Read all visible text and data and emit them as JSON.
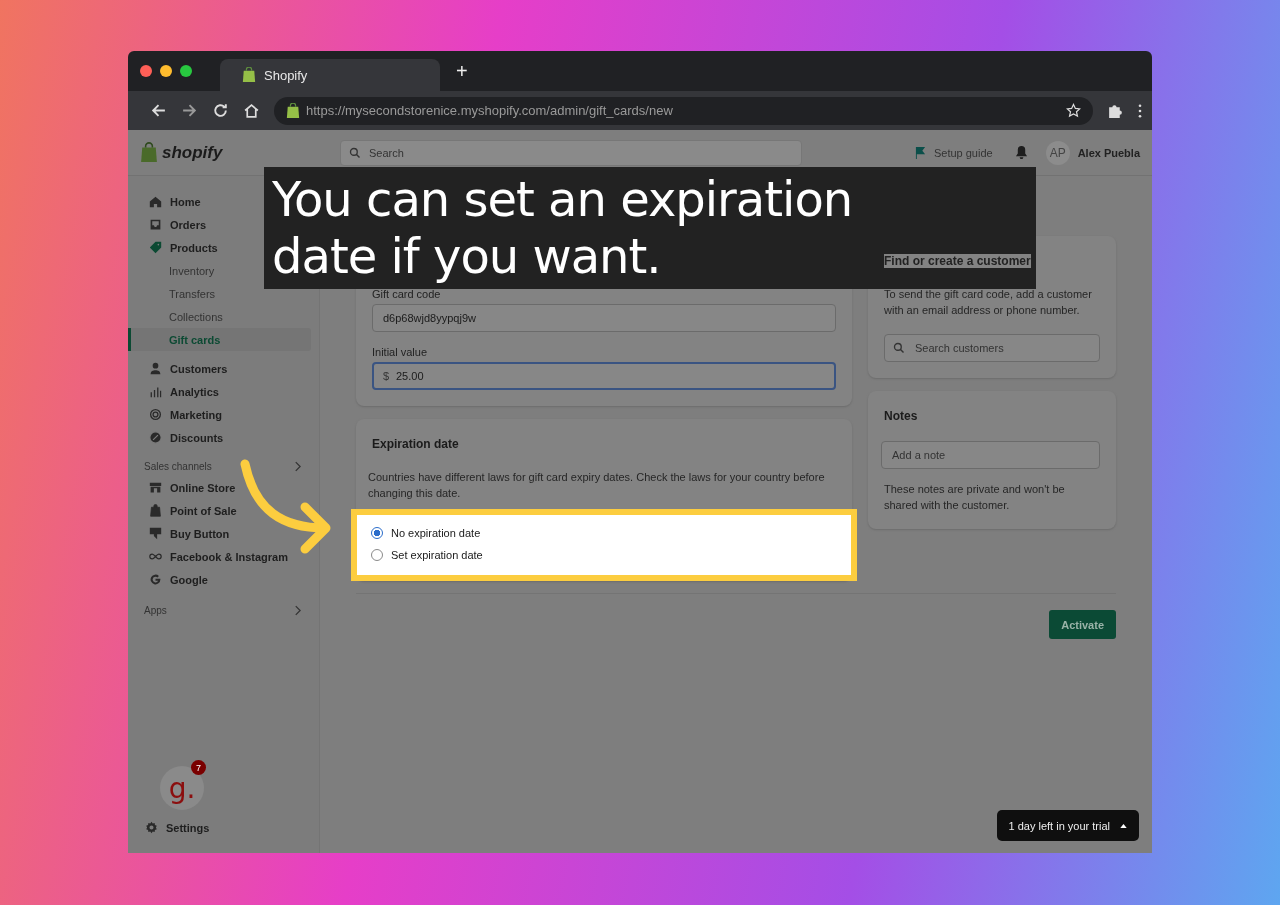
{
  "browser": {
    "tab_title": "Shopify",
    "new_tab": "+",
    "url": "https://mysecondstorenice.myshopify.com/admin/gift_cards/new"
  },
  "topbar": {
    "logo": "shopify",
    "search_placeholder": "Search",
    "setup_guide": "Setup guide",
    "user_initials": "AP",
    "user_name": "Alex Puebla"
  },
  "sidebar": {
    "items": [
      {
        "kind": "home",
        "label": "Home",
        "selected": false
      },
      {
        "kind": "orders",
        "label": "Orders",
        "selected": false
      },
      {
        "kind": "products",
        "label": "Products",
        "selected": false,
        "children": [
          {
            "label": "Inventory",
            "selected": false
          },
          {
            "label": "Transfers",
            "selected": false
          },
          {
            "label": "Collections",
            "selected": false
          },
          {
            "label": "Gift cards",
            "selected": true
          }
        ]
      },
      {
        "kind": "customers",
        "label": "Customers",
        "selected": false
      },
      {
        "kind": "analytics",
        "label": "Analytics",
        "selected": false
      },
      {
        "kind": "marketing",
        "label": "Marketing",
        "selected": false
      },
      {
        "kind": "discounts",
        "label": "Discounts",
        "selected": false
      }
    ],
    "channels_heading": "Sales channels",
    "channels": [
      {
        "kind": "store",
        "label": "Online Store"
      },
      {
        "kind": "pos",
        "label": "Point of Sale"
      },
      {
        "kind": "buy",
        "label": "Buy Button"
      },
      {
        "kind": "meta",
        "label": "Facebook & Instagram"
      },
      {
        "kind": "google",
        "label": "Google"
      }
    ],
    "apps_heading": "Apps",
    "settings": "Settings"
  },
  "gift_card": {
    "code_label": "Gift card code",
    "code": "d6p68wjd8yypqj9w",
    "value_label": "Initial value",
    "currency": "$",
    "value": "25.00"
  },
  "expiration": {
    "title": "Expiration date",
    "description": "Countries have different laws for gift card expiry dates. Check the laws for your country before changing this date.",
    "options": [
      {
        "label": "No expiration date",
        "selected": true
      },
      {
        "label": "Set expiration date",
        "selected": false
      }
    ]
  },
  "customer": {
    "title": "Find or create a customer",
    "description": "To send the gift card code, add a customer with an email address or phone number.",
    "search_placeholder": "Search customers"
  },
  "notes": {
    "title": "Notes",
    "placeholder": "Add a note",
    "hint": "These notes are private and won't be shared with the customer."
  },
  "activate": "Activate",
  "app_badge": {
    "letter": "g.",
    "count": "7"
  },
  "trial": "1 day left in your trial",
  "caption": "You can set an expiration date if you want."
}
